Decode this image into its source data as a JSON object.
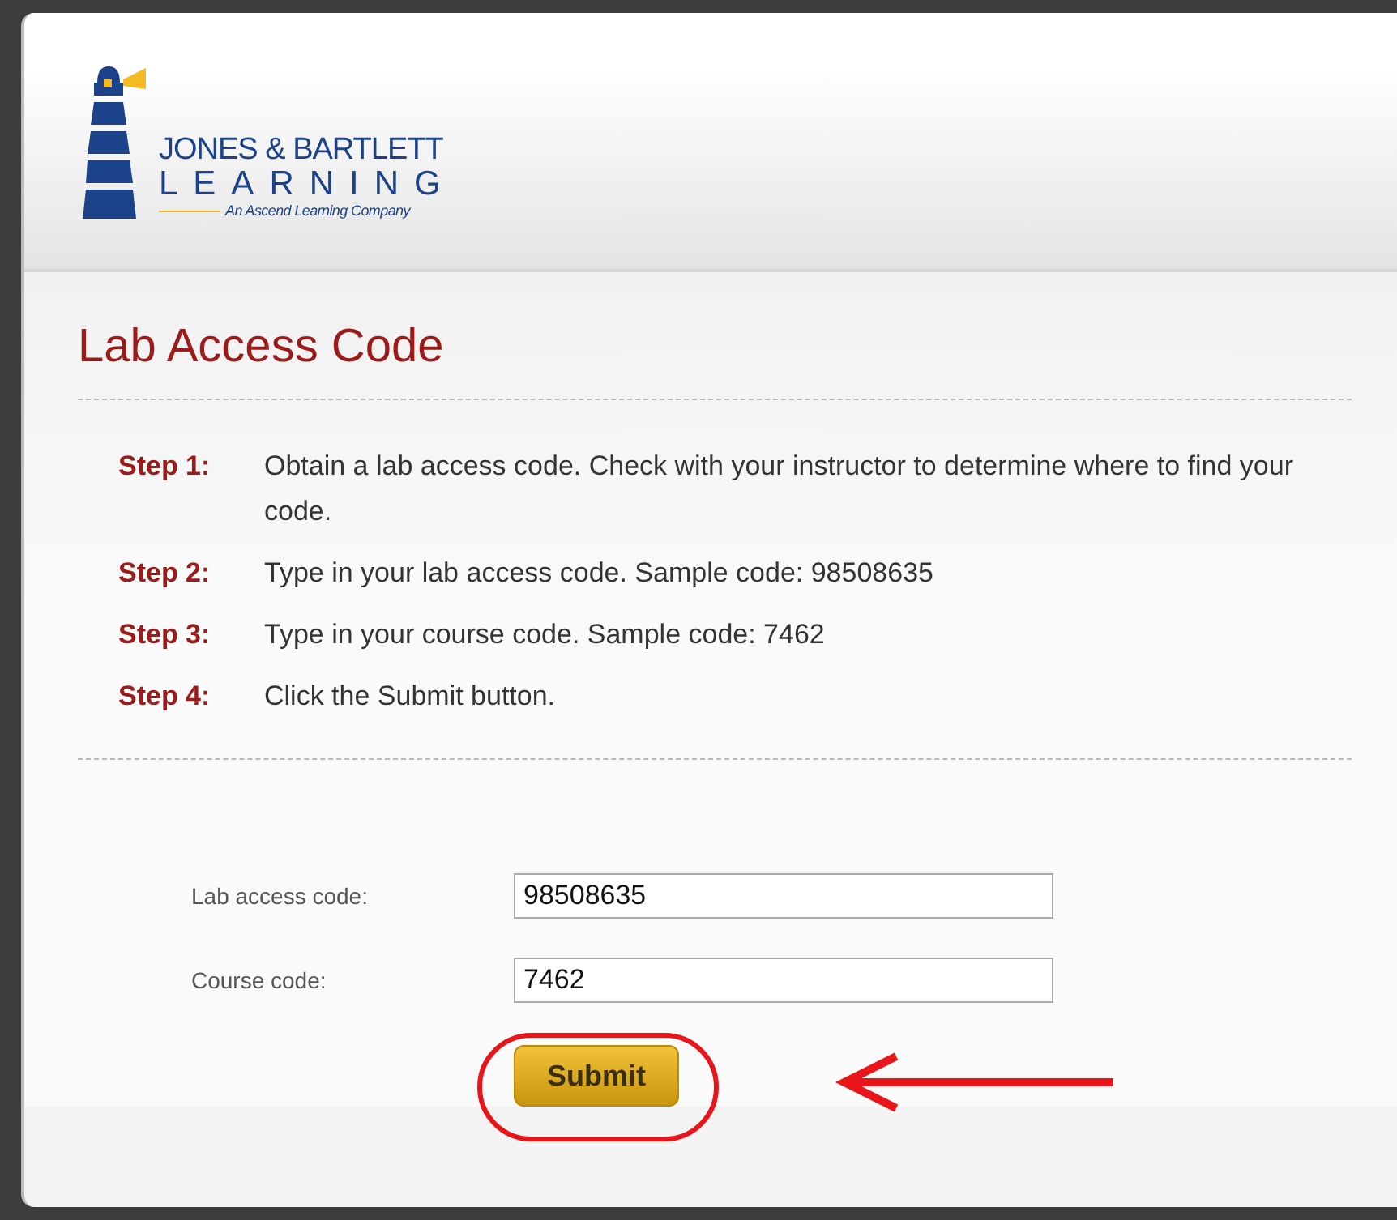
{
  "logo": {
    "line1": "JONES & BARTLETT",
    "line2": "LEARNING",
    "tagline": "An Ascend Learning Company"
  },
  "title": "Lab Access Code",
  "steps": [
    {
      "label": "Step 1:",
      "text": "Obtain a lab access code. Check with your instructor to determine where to find your code."
    },
    {
      "label": "Step 2:",
      "text": "Type in your lab access code. Sample code: 98508635"
    },
    {
      "label": "Step 3:",
      "text": "Type in your course code. Sample code: 7462"
    },
    {
      "label": "Step 4:",
      "text": "Click the Submit button."
    }
  ],
  "fields": [
    {
      "label": "Lab access code:",
      "value": "98508635"
    },
    {
      "label": "Course code:",
      "value": "7462"
    }
  ],
  "submit_button": "Submit"
}
